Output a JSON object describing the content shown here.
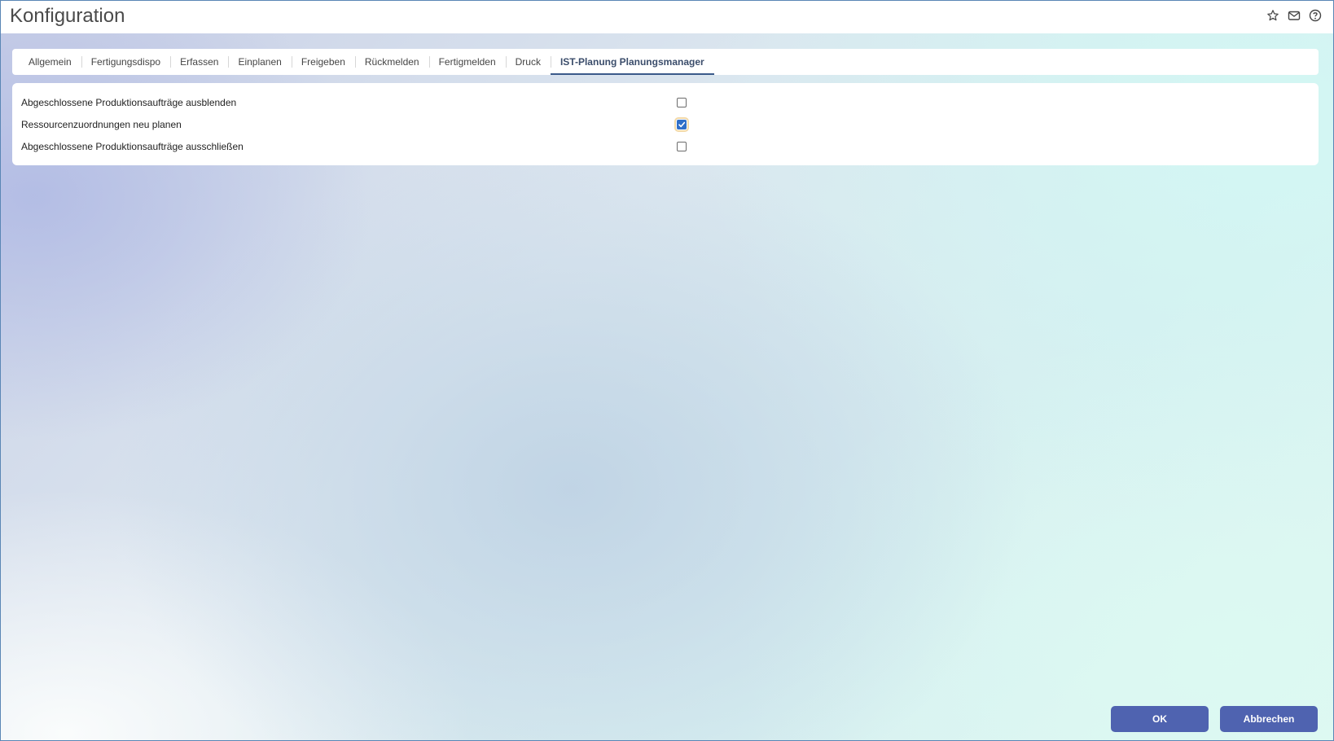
{
  "window": {
    "title": "Konfiguration",
    "icons": [
      "star-icon",
      "mail-icon",
      "help-icon"
    ]
  },
  "tabs": [
    {
      "label": "Allgemein",
      "active": false
    },
    {
      "label": "Fertigungsdispo",
      "active": false
    },
    {
      "label": "Erfassen",
      "active": false
    },
    {
      "label": "Einplanen",
      "active": false
    },
    {
      "label": "Freigeben",
      "active": false
    },
    {
      "label": "Rückmelden",
      "active": false
    },
    {
      "label": "Fertigmelden",
      "active": false
    },
    {
      "label": "Druck",
      "active": false
    },
    {
      "label": "IST-Planung Planungsmanager",
      "active": true
    }
  ],
  "settings": [
    {
      "label": "Abgeschlossene Produktionsaufträge ausblenden",
      "checked": false
    },
    {
      "label": "Ressourcenzuordnungen neu planen",
      "checked": true
    },
    {
      "label": "Abgeschlossene Produktionsaufträge ausschließen",
      "checked": false
    }
  ],
  "footer": {
    "ok_label": "OK",
    "cancel_label": "Abbrechen"
  },
  "colors": {
    "accent": "#4f63b0",
    "active_tab": "#3b4d6b",
    "checkbox_checked": "#2f6fc8"
  }
}
